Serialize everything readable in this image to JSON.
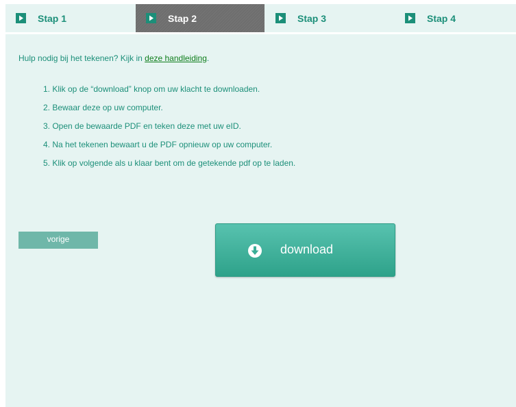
{
  "steps": [
    {
      "label": "Stap 1",
      "active": false
    },
    {
      "label": "Stap 2",
      "active": true
    },
    {
      "label": "Stap 3",
      "active": false
    },
    {
      "label": "Stap 4",
      "active": false
    }
  ],
  "help": {
    "prefix": "Hulp nodig bij het tekenen? Kijk in",
    "link_text": "deze handleiding",
    "suffix": "."
  },
  "instructions": [
    "1.  Klik op de “download” knop om uw klacht te downloaden.",
    "2.  Bewaar deze op uw computer.",
    "3.  Open de bewaarde PDF en teken deze met uw eID.",
    "4.  Na het tekenen bewaart u de PDF opnieuw op uw computer.",
    "5.  Klik op volgende als u klaar bent om de getekende pdf op te laden."
  ],
  "buttons": {
    "previous_label": "vorige",
    "download_label": "download"
  },
  "colors": {
    "accent": "#1c8f79",
    "link": "#0e7d1b",
    "background": "#e6f4f2",
    "active_step": "#6e6e6e"
  }
}
